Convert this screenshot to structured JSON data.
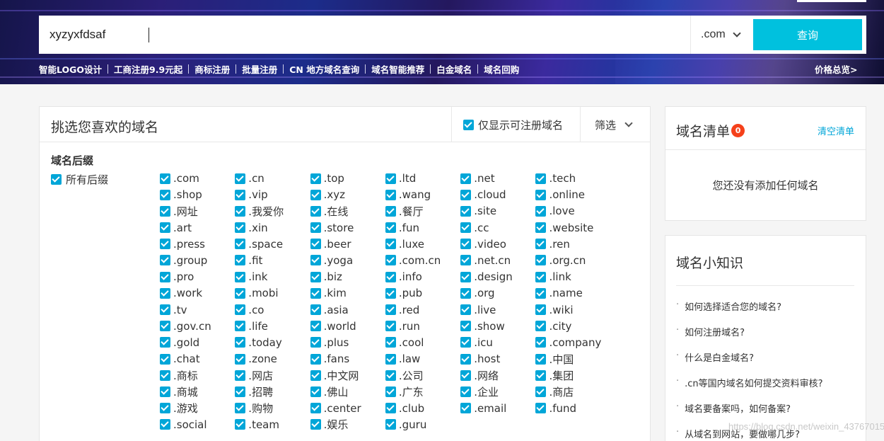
{
  "search": {
    "query": "xyzyxfdsaf",
    "suffix": ".com",
    "button_label": "查询"
  },
  "quick_links": [
    "智能LOGO设计",
    "工商注册9.9元起",
    "商标注册",
    "批量注册",
    "CN 地方域名查询",
    "域名智能推荐",
    "白金域名",
    "域名回购"
  ],
  "price_link": "价格总览>",
  "main": {
    "title": "挑选您喜欢的域名",
    "only_available_label": "仅显示可注册域名",
    "only_available_checked": true,
    "filter_label": "筛选",
    "section_label": "域名后缀",
    "all_suffix_label": "所有后缀",
    "suffixes": [
      ".com",
      ".cn",
      ".top",
      ".ltd",
      ".net",
      ".tech",
      ".shop",
      ".vip",
      ".xyz",
      ".wang",
      ".cloud",
      ".online",
      ".网址",
      ".我爱你",
      ".在线",
      ".餐厅",
      ".site",
      ".love",
      ".art",
      ".xin",
      ".store",
      ".fun",
      ".cc",
      ".website",
      ".press",
      ".space",
      ".beer",
      ".luxe",
      ".video",
      ".ren",
      ".group",
      ".fit",
      ".yoga",
      ".com.cn",
      ".net.cn",
      ".org.cn",
      ".pro",
      ".ink",
      ".biz",
      ".info",
      ".design",
      ".link",
      ".work",
      ".mobi",
      ".kim",
      ".pub",
      ".org",
      ".name",
      ".tv",
      ".co",
      ".asia",
      ".red",
      ".live",
      ".wiki",
      ".gov.cn",
      ".life",
      ".world",
      ".run",
      ".show",
      ".city",
      ".gold",
      ".today",
      ".plus",
      ".cool",
      ".icu",
      ".company",
      ".chat",
      ".zone",
      ".fans",
      ".law",
      ".host",
      ".中国",
      ".商标",
      ".网店",
      ".中文网",
      ".公司",
      ".网络",
      ".集团",
      ".商城",
      ".招聘",
      ".佛山",
      ".广东",
      ".企业",
      ".商店",
      ".游戏",
      ".购物",
      ".center",
      ".club",
      ".email",
      ".fund",
      ".social",
      ".team",
      ".娱乐",
      ".guru"
    ]
  },
  "cart": {
    "title": "域名清单",
    "count": "0",
    "clear_label": "清空清单",
    "empty_text": "您还没有添加任何域名"
  },
  "tips": {
    "title": "域名小知识",
    "items": [
      "如何选择适合您的域名?",
      "如何注册域名?",
      "什么是白金域名?",
      ".cn等国内域名如何提交资料审核?",
      "域名要备案吗，如何备案?",
      "从域名到网站，要做哪几步?"
    ]
  },
  "watermark": "https://blog.csdn.net/weixin_43767015",
  "colors": {
    "accent": "#00c1de",
    "checkbox": "#00a6d8",
    "badge": "#f5401a"
  }
}
